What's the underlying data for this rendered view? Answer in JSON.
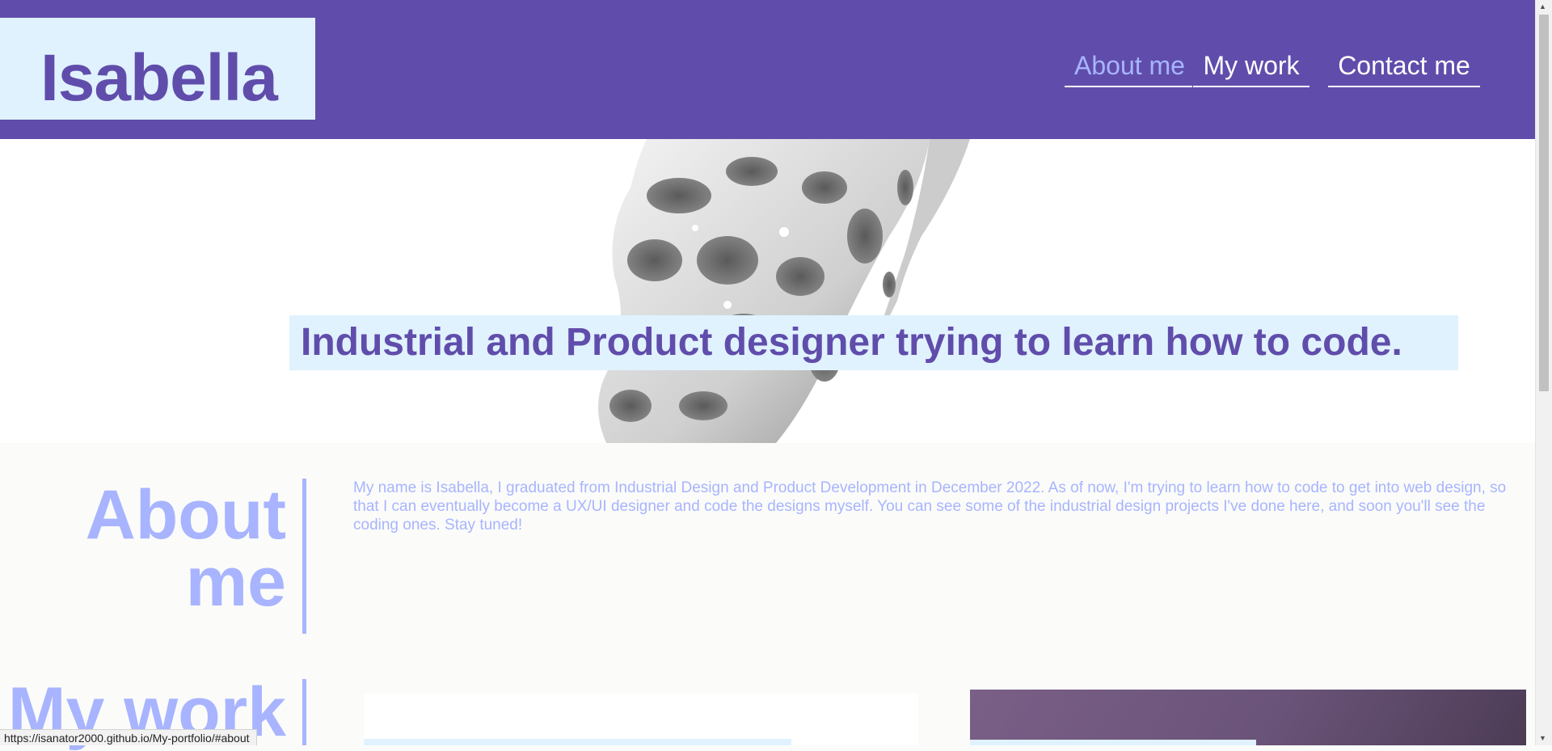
{
  "header": {
    "logo": "Isabella",
    "nav": [
      {
        "label": "About me",
        "active": true
      },
      {
        "label": "My work",
        "active": false
      },
      {
        "label": "Contact me",
        "active": false
      }
    ]
  },
  "hero": {
    "tagline": "Industrial and Product designer trying to learn how to code."
  },
  "about": {
    "title": "About me",
    "text": "My name is Isabella, I graduated from Industrial Design and Product Development in December 2022. As of now, I'm trying to learn how to code to get into web design, so that I can eventually become a UX/UI designer and code the designs myself. You can see some of the industrial design projects I've done here, and soon you'll see the coding ones. Stay tuned!"
  },
  "work": {
    "title": "My work"
  },
  "status_bar": {
    "url": "https://isanator2000.github.io/My-portfolio/#about"
  },
  "colors": {
    "header_bg": "#604dab",
    "logo_bg": "#e0f2fe",
    "accent": "#a8b4ff",
    "page_bg": "#fbfcf9"
  }
}
